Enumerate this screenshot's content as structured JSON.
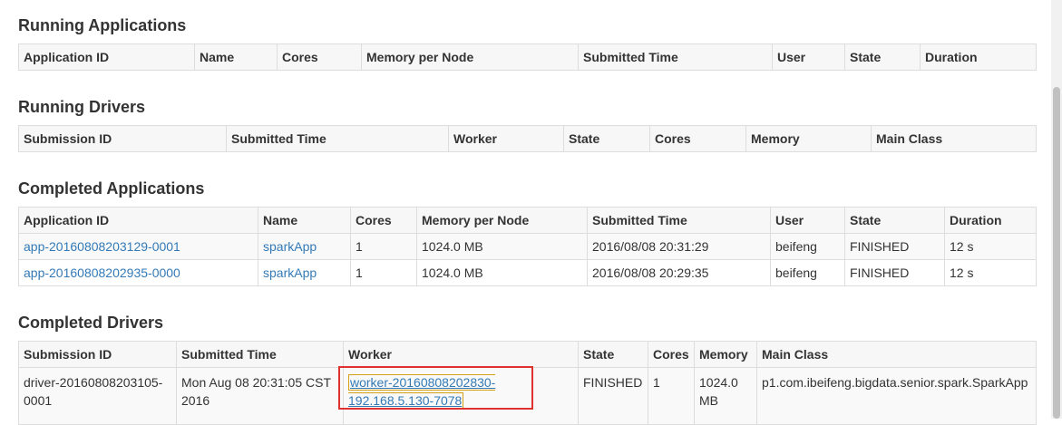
{
  "running_applications": {
    "title": "Running Applications",
    "headers": [
      "Application ID",
      "Name",
      "Cores",
      "Memory per Node",
      "Submitted Time",
      "User",
      "State",
      "Duration"
    ]
  },
  "running_drivers": {
    "title": "Running Drivers",
    "headers": [
      "Submission ID",
      "Submitted Time",
      "Worker",
      "State",
      "Cores",
      "Memory",
      "Main Class"
    ]
  },
  "completed_applications": {
    "title": "Completed Applications",
    "headers": [
      "Application ID",
      "Name",
      "Cores",
      "Memory per Node",
      "Submitted Time",
      "User",
      "State",
      "Duration"
    ],
    "rows": [
      {
        "app_id": "app-20160808203129-0001",
        "name": "sparkApp",
        "cores": "1",
        "memory": "1024.0 MB",
        "submitted": "2016/08/08 20:31:29",
        "user": "beifeng",
        "state": "FINISHED",
        "duration": "12 s"
      },
      {
        "app_id": "app-20160808202935-0000",
        "name": "sparkApp",
        "cores": "1",
        "memory": "1024.0 MB",
        "submitted": "2016/08/08 20:29:35",
        "user": "beifeng",
        "state": "FINISHED",
        "duration": "12 s"
      }
    ]
  },
  "completed_drivers": {
    "title": "Completed Drivers",
    "headers": [
      "Submission ID",
      "Submitted Time",
      "Worker",
      "State",
      "Cores",
      "Memory",
      "Main Class"
    ],
    "rows": [
      {
        "submission_id": "driver-20160808203105-0001",
        "submitted": "Mon Aug 08 20:31:05 CST 2016",
        "worker": "worker-20160808202830-192.168.5.130-7078",
        "state": "FINISHED",
        "cores": "1",
        "memory": "1024.0 MB",
        "main_class": "p1.com.ibeifeng.bigdata.senior.spark.SparkApp"
      }
    ]
  },
  "colors": {
    "link": "#337ab7",
    "highlight_box": "#e03131",
    "highlight_link_border": "#d4a017"
  }
}
